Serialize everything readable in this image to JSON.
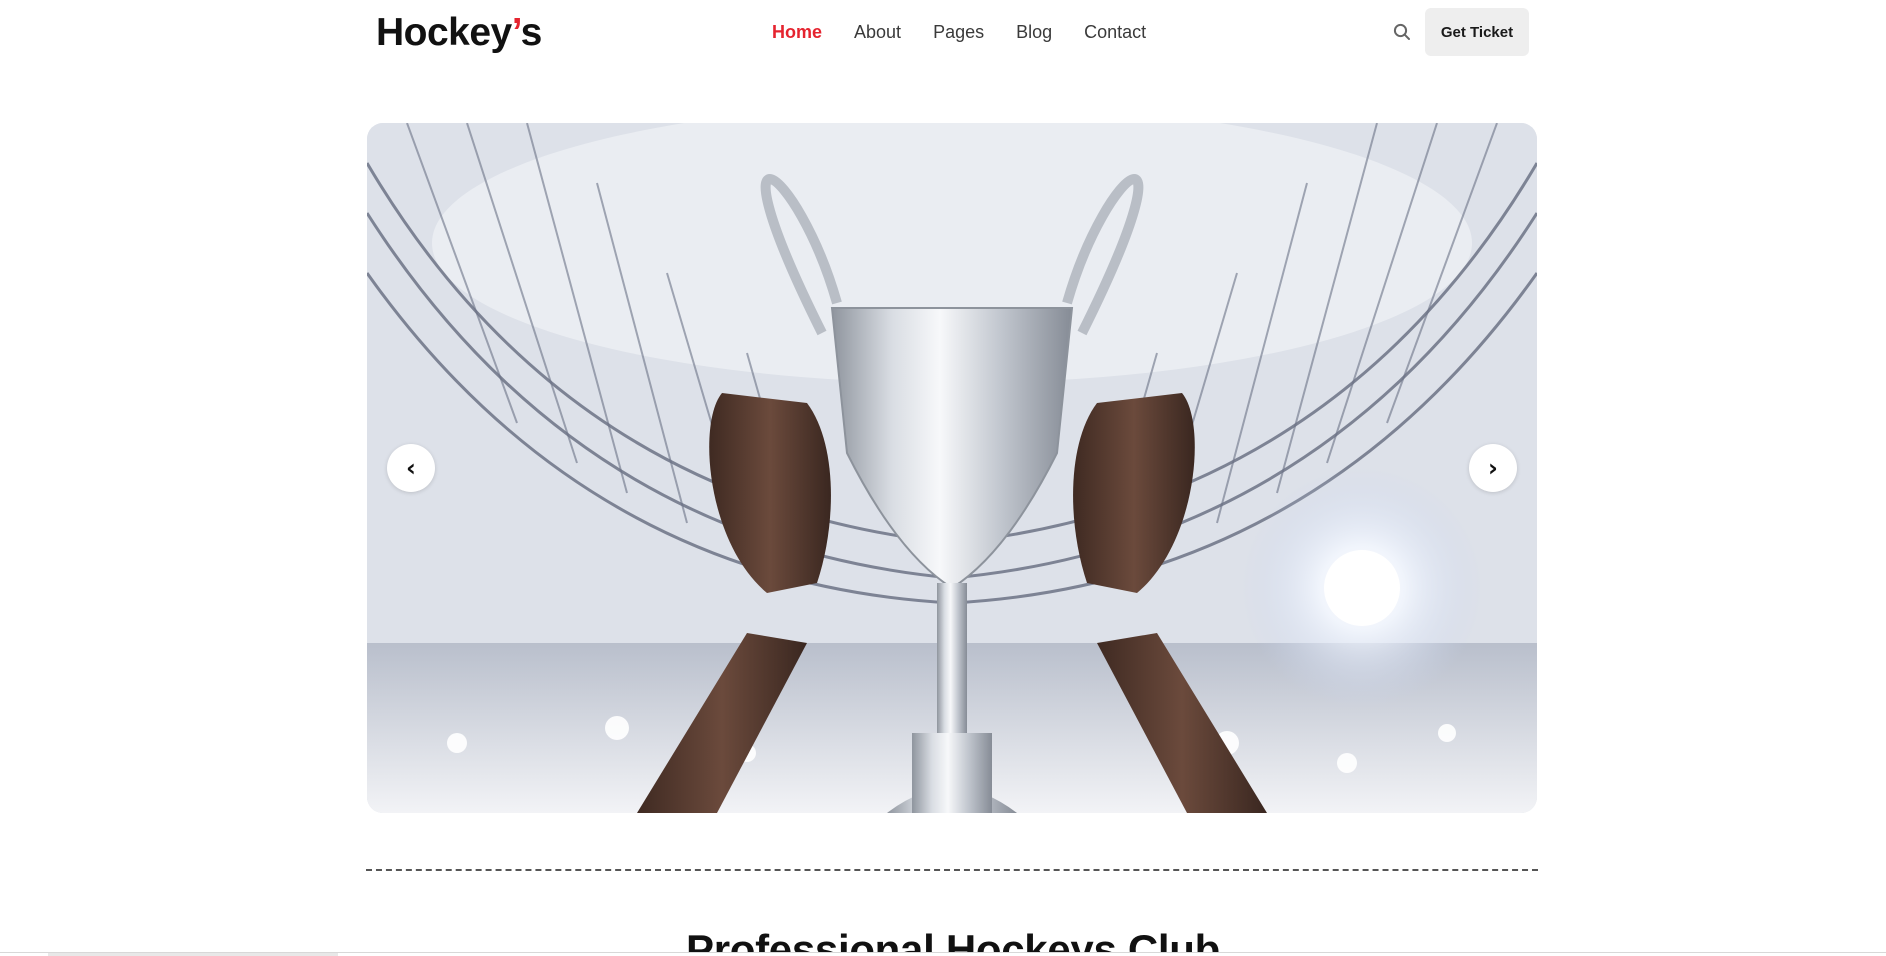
{
  "brand": {
    "name_main": "Hockey",
    "name_apostrophe": "’",
    "name_end": "s",
    "accent_color": "#e5242f"
  },
  "nav": {
    "items": [
      {
        "label": "Home",
        "active": true
      },
      {
        "label": "About",
        "active": false
      },
      {
        "label": "Pages",
        "active": false
      },
      {
        "label": "Blog",
        "active": false
      },
      {
        "label": "Contact",
        "active": false
      }
    ]
  },
  "header": {
    "search_icon": "search-icon",
    "ticket_label": "Get Ticket"
  },
  "hero": {
    "prev_label": "‹",
    "next_label": "›",
    "image_subject": "trophy-in-stadium"
  },
  "section": {
    "title": "Professional Hockeys Club"
  }
}
